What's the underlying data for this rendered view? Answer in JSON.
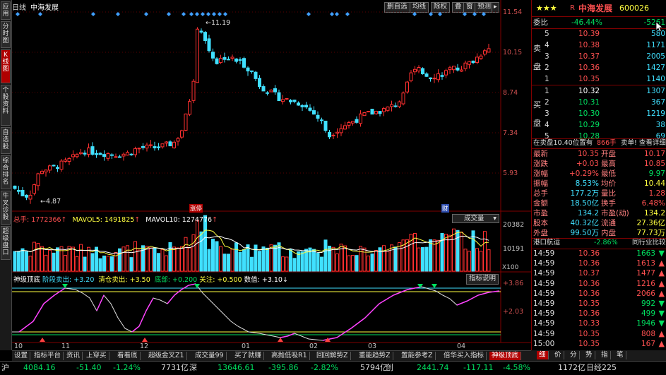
{
  "left_tabs": [
    "应用",
    "分时图",
    "K线图",
    "个股资料",
    "自选股",
    "综合排名",
    "牛叉诊股",
    "超级盘口"
  ],
  "left_tabs_active": 2,
  "chart": {
    "period": "日线",
    "stock_name": "中海发展",
    "toolbar": [
      "删自选",
      "均线",
      "除权",
      "叠",
      "窗",
      "预测"
    ],
    "price_ticks": [
      "11.54",
      "10.15",
      "8.74",
      "7.34",
      "5.93"
    ],
    "high_marker": "11.19",
    "low_marker": "4.87",
    "markers": [
      "涨停",
      "财"
    ],
    "volume_info": {
      "total": "总手: 1772366",
      "mavol5": "MAVOL5: 1491825",
      "mavol10": "MAVOL10: 1274776",
      "dropdown": "成交量",
      "ticks": [
        "20382",
        "10191"
      ],
      "unit": "X100"
    },
    "indicator": {
      "name": "神级顶底",
      "items": [
        "阶段卖出: +3.20",
        "清仓卖出: +3.50",
        "底部: +0.200",
        "关注: +0.500",
        "数值: +3.10"
      ],
      "help_button": "指标说明",
      "ticks": [
        "+3.86",
        "+2.03"
      ]
    },
    "time_axis": [
      "10",
      "11",
      "12",
      "01",
      "02",
      "03",
      "04"
    ]
  },
  "chart_data": {
    "type": "candlestick",
    "price_range": [
      4.5,
      11.8
    ],
    "high": 11.19,
    "low": 4.87,
    "volume_range_x100": [
      0,
      20382
    ]
  },
  "quote": {
    "stars": "★★★",
    "r_badge": "R",
    "name": "中海发展",
    "code": "600026",
    "weibi_label": "委比",
    "weibi": "-46.44%",
    "weicha": "-5261",
    "sell_label": "卖盘",
    "buy_label": "买盘",
    "asks": [
      {
        "lvl": "5",
        "price": "10.39",
        "vol": "580"
      },
      {
        "lvl": "4",
        "price": "10.38",
        "vol": "1171"
      },
      {
        "lvl": "3",
        "price": "10.37",
        "vol": "2005"
      },
      {
        "lvl": "2",
        "price": "10.36",
        "vol": "1427"
      },
      {
        "lvl": "1",
        "price": "10.35",
        "vol": "1140"
      }
    ],
    "bids": [
      {
        "lvl": "1",
        "price": "10.32",
        "vol": "1307"
      },
      {
        "lvl": "2",
        "price": "10.31",
        "vol": "367"
      },
      {
        "lvl": "3",
        "price": "10.30",
        "vol": "1219"
      },
      {
        "lvl": "4",
        "price": "10.29",
        "vol": "38"
      },
      {
        "lvl": "5",
        "price": "10.28",
        "vol": "69"
      }
    ],
    "notice": "在卖盘10.40位置有",
    "notice_vol": "866手",
    "notice_action": "卖单! 查看详细",
    "stats": [
      {
        "l1": "最新",
        "v1": "10.35",
        "l2": "开盘",
        "v2": "10.17"
      },
      {
        "l1": "涨跌",
        "v1": "+0.03",
        "l2": "最高",
        "v2": "10.85"
      },
      {
        "l1": "涨幅",
        "v1": "+0.29%",
        "l2": "最低",
        "v2": "9.97"
      },
      {
        "l1": "振幅",
        "v1": "8.53%",
        "l2": "均价",
        "v2": "10.44"
      },
      {
        "l1": "总手",
        "v1": "177.2万",
        "l2": "量比",
        "v2": "1.28"
      },
      {
        "l1": "金额",
        "v1": "18.50亿",
        "l2": "换手",
        "v2": "6.48%"
      },
      {
        "l1": "市盈",
        "v1": "134.2",
        "l2": "市盈(动)",
        "v2": "134.2"
      },
      {
        "l1": "股本",
        "v1": "40.32亿",
        "l2": "流通",
        "v2": "27.36亿"
      },
      {
        "l1": "外盘",
        "v1": "99.50万",
        "l2": "内盘",
        "v2": "77.73万"
      }
    ],
    "sector": "港口航运",
    "sector_change": "-2.86%",
    "sector_link": "同行业比较",
    "ticks": [
      {
        "t": "14:59",
        "p": "10.36",
        "v": "1663",
        "d": "down"
      },
      {
        "t": "14:59",
        "p": "10.36",
        "v": "1613",
        "d": "up"
      },
      {
        "t": "14:59",
        "p": "10.37",
        "v": "1477",
        "d": "up"
      },
      {
        "t": "14:59",
        "p": "10.36",
        "v": "1216",
        "d": "up"
      },
      {
        "t": "14:59",
        "p": "10.36",
        "v": "2066",
        "d": "up"
      },
      {
        "t": "14:59",
        "p": "10.35",
        "v": "992",
        "d": "down"
      },
      {
        "t": "14:59",
        "p": "10.36",
        "v": "499",
        "d": "down"
      },
      {
        "t": "14:59",
        "p": "10.33",
        "v": "1946",
        "d": "down"
      },
      {
        "t": "14:59",
        "p": "10.35",
        "v": "808",
        "d": "up"
      },
      {
        "t": "15:00",
        "p": "10.35",
        "v": "167",
        "d": "up"
      }
    ],
    "bottom_tabs": [
      "细",
      "价",
      "分",
      "势",
      "指",
      "笔"
    ]
  },
  "bottom_tabs": [
    "设置",
    "指标平台",
    "资讯",
    "上穿买",
    "看看底",
    "超级金叉Z1",
    "成交量99",
    "买了就赚",
    "高抛低吸R1",
    "回回解势Z",
    "重能趋势Z",
    "置能参考Z",
    "倍华买入指标",
    "神级顶底"
  ],
  "bottom_tabs_active": 13,
  "status": {
    "sh_label": "沪",
    "sh_index": "4084.16",
    "sh_change": "-51.40",
    "sh_pct": "-1.24%",
    "sh_amount": "7731亿",
    "sz_label": "深",
    "sz_index": "13646.61",
    "sz_change": "-395.86",
    "sz_pct": "-2.82%",
    "sz_amount": "5794亿",
    "cy_label": "创",
    "cy_index": "2441.74",
    "cy_change": "-117.11",
    "cy_pct": "-4.58%",
    "right": "1172亿",
    "right2": "日经225"
  }
}
